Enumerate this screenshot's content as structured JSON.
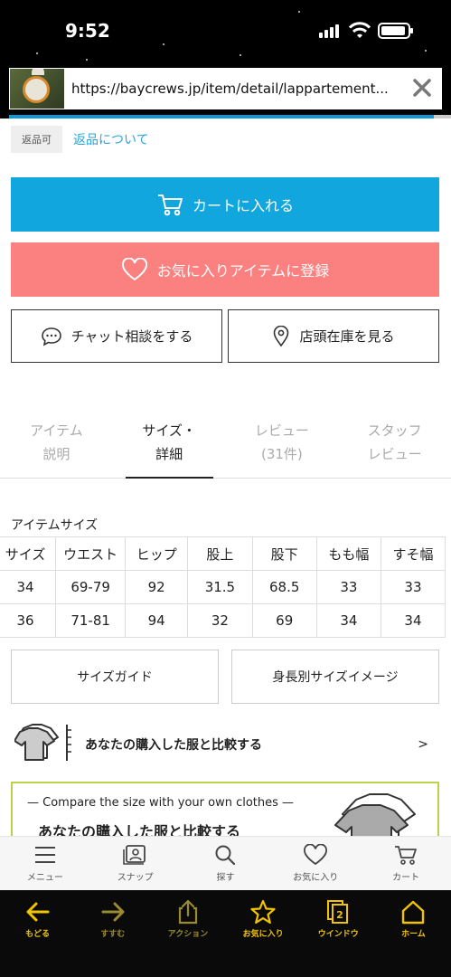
{
  "status_bar": {
    "time": "9:52"
  },
  "url_bar": {
    "url": "https://baycrews.jp/item/detail/lappartement..."
  },
  "returns": {
    "badge": "返品可",
    "link": "返品について"
  },
  "buttons": {
    "cart": "カートに入れる",
    "favorite": "お気に入りアイテムに登録",
    "chat": "チャット相談をする",
    "store": "店頭在庫を見る",
    "size_guide": "サイズガイド",
    "height_image": "身長別サイズイメージ"
  },
  "tabs": [
    {
      "line1": "アイテム",
      "line2": "説明"
    },
    {
      "line1": "サイズ・",
      "line2": "詳細"
    },
    {
      "line1": "レビュー",
      "line2": "(31件)"
    },
    {
      "line1": "スタッフ",
      "line2": "レビュー"
    }
  ],
  "size_section": {
    "title": "アイテムサイズ",
    "headers": [
      "サイズ",
      "ウエスト",
      "ヒップ",
      "股上",
      "股下",
      "もも幅",
      "すそ幅"
    ],
    "rows": [
      [
        "34",
        "69-79",
        "92",
        "31.5",
        "68.5",
        "33",
        "33"
      ],
      [
        "36",
        "71-81",
        "94",
        "32",
        "69",
        "34",
        "34"
      ]
    ]
  },
  "compare": {
    "text": "あなたの購入した服と比較する",
    "chevron": ">"
  },
  "banner": {
    "english": "— Compare the size with your own clothes —",
    "japanese": "あなたの購入した服と比較する"
  },
  "site_nav": [
    {
      "label": "メニュー",
      "icon": "menu-icon"
    },
    {
      "label": "スナップ",
      "icon": "snap-icon"
    },
    {
      "label": "探す",
      "icon": "search-icon"
    },
    {
      "label": "お気に入り",
      "icon": "heart-icon"
    },
    {
      "label": "カート",
      "icon": "cart-icon"
    }
  ],
  "toolbar": [
    {
      "label": "もどる",
      "icon": "back-arrow-icon"
    },
    {
      "label": "すすむ",
      "icon": "forward-arrow-icon"
    },
    {
      "label": "アクション",
      "icon": "share-icon"
    },
    {
      "label": "お気に入り",
      "icon": "star-icon"
    },
    {
      "label": "ウインドウ",
      "icon": "windows-icon",
      "count": "2"
    },
    {
      "label": "ホーム",
      "icon": "home-icon"
    }
  ],
  "colors": {
    "cart": "#12a6de",
    "favorite": "#fb8080",
    "toolbar_accent": "#f2c400",
    "banner_border": "#b9d24a",
    "link": "#2aa4d8"
  }
}
